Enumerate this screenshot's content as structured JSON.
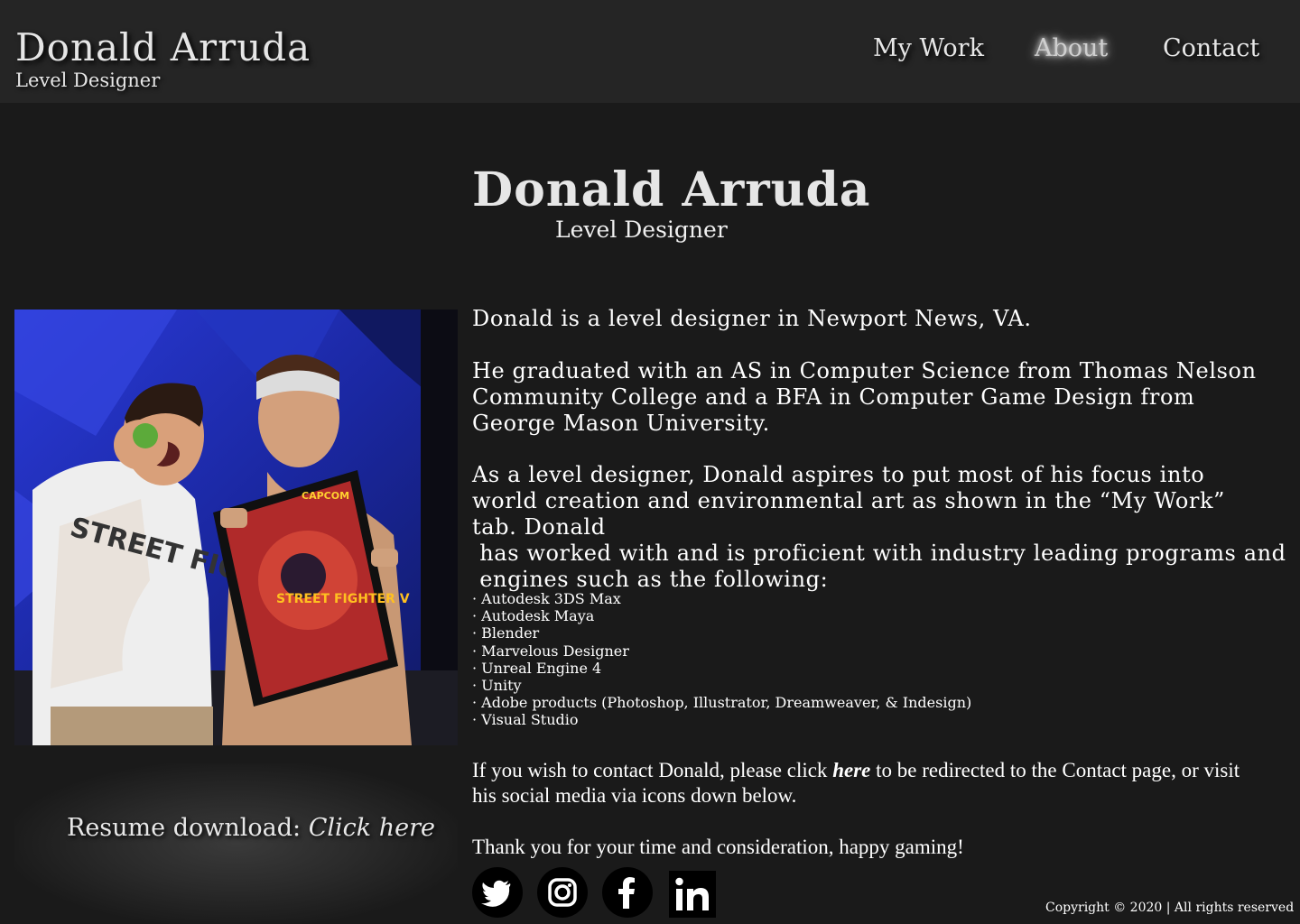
{
  "header": {
    "name": "Donald Arruda",
    "subtitle": "Level Designer",
    "nav": {
      "work": "My Work",
      "about": "About",
      "contact": "Contact"
    }
  },
  "hero": {
    "name": "Donald Arruda",
    "subtitle": "Level Designer"
  },
  "bio": {
    "p1": "Donald is a level designer in Newport News, VA.",
    "p2": "He graduated with an AS in Computer Science from Thomas Nelson Community College and a BFA in Computer Game Design from George Mason University.",
    "p3a": "As a level designer, Donald aspires to put most of his focus into world creation and environmental art as shown in the “My Work” tab. Donald",
    "p3b": " has worked with and is proficient with industry leading programs and",
    "p3c": " engines such as the following:"
  },
  "skills": [
    "· Autodesk 3DS Max",
    "· Autodesk Maya",
    "· Blender",
    "· Marvelous Designer",
    "· Unreal Engine 4",
    "· Unity",
    "· Adobe products (Photoshop, Illustrator, Dreamweaver, & Indesign)",
    "· Visual Studio"
  ],
  "contact": {
    "before": "If you wish to contact Donald, please click ",
    "link": "here",
    "after": " to be redirected to the Contact page, or visit his social media via icons down below."
  },
  "thanks": "Thank you for your time and consideration, happy gaming!",
  "resume": {
    "label": "Resume download: ",
    "link": "Click here"
  },
  "photo": {
    "shirt_text": "STREET FIGHTER 30",
    "poster_brand": "CAPCOM",
    "poster_title": "STREET FIGHTER V"
  },
  "social": [
    "twitter-icon",
    "instagram-icon",
    "facebook-icon",
    "linkedin-icon"
  ],
  "footer": {
    "copyright": "Copyright © 2020 | All rights reserved"
  },
  "colors": {
    "background": "#1a1a1a",
    "header": "#252525",
    "text": "#ffffff"
  }
}
